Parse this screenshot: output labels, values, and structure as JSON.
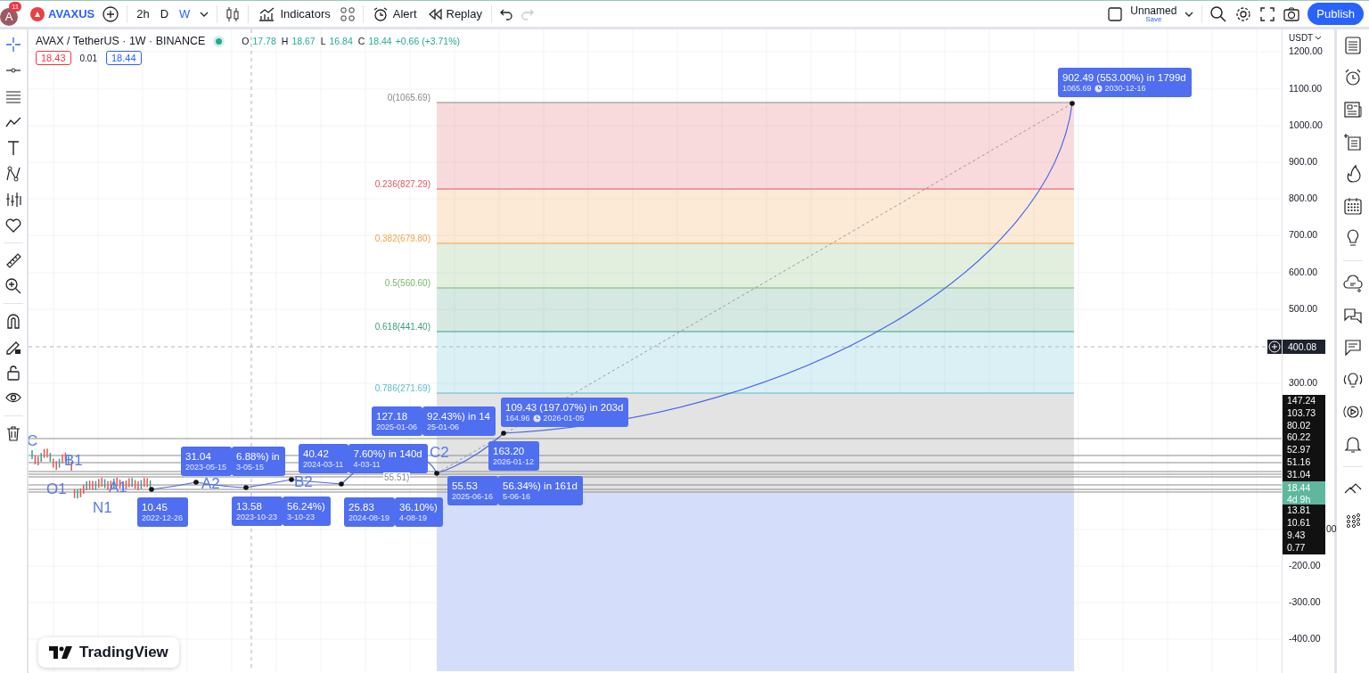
{
  "top_bar": {
    "avatar": "A",
    "notifications": "11",
    "symbol": "AVAXUS",
    "timeframes": [
      {
        "label": "2h",
        "selected": false
      },
      {
        "label": "D",
        "selected": false
      },
      {
        "label": "W",
        "selected": true
      }
    ],
    "tools": [
      {
        "kind": "indicators",
        "label": "Indicators"
      },
      {
        "kind": "alert",
        "label": "Alert"
      },
      {
        "kind": "replay",
        "label": "Replay"
      }
    ],
    "redo_disabled": true,
    "layout_name": "Unnamed",
    "save_label": "Save",
    "publish_label": "Publish"
  },
  "legend": {
    "title": "AVAX / TetherUS · 1W · BINANCE",
    "ohlc": [
      {
        "key": "O",
        "value": "17.78"
      },
      {
        "key": "H",
        "value": "18.67"
      },
      {
        "key": "L",
        "value": "16.84"
      },
      {
        "key": "C",
        "value": "18.44"
      }
    ],
    "change": "+0.66 (+3.71%)",
    "sell": "18.43",
    "spread": "0.01",
    "buy": "18.44"
  },
  "fib_levels": [
    {
      "label": "0(1065.69)",
      "color": "#8a8a8a"
    },
    {
      "label": "0.236(827.29)",
      "color": "#e0575f"
    },
    {
      "label": "0.382(679.80)",
      "color": "#f3a14b"
    },
    {
      "label": "0.5(560.60)",
      "color": "#7cb66e"
    },
    {
      "label": "0.618(441.40)",
      "color": "#3f9c7b"
    },
    {
      "label": "0.786(271.69)",
      "color": "#5bbcd0"
    }
  ],
  "fib_extra_label": "55.51)",
  "wave_labels": [
    "C",
    "B1",
    "O1",
    "A1",
    "N1",
    "A2",
    "B2",
    "C2"
  ],
  "annotations": [
    {
      "line1": "902.49 (553.00%) in 1799d",
      "line2": "1065.69",
      "line2b": "2030-12-16"
    },
    {
      "line1": "109.43 (197.07%) in 203d",
      "line2": "164.96",
      "line2b": "2026-01-05"
    },
    {
      "line1": "127.18",
      "line2": "2025-01-06"
    },
    {
      "line1": "92.43%) in 14",
      "line2": "25-01-06"
    },
    {
      "line1": "31.04",
      "line2": "2023-05-15"
    },
    {
      "line1": "6.88%) in",
      "line2": "3-05-15"
    },
    {
      "line1": "40.42",
      "line2": "2024-03-11"
    },
    {
      "line1": "7.60%) in 140d",
      "line2": "4-03-11"
    },
    {
      "line1": "163.20",
      "line2": "2026-01-12"
    },
    {
      "line1": "10.45",
      "line2": "2022-12-26"
    },
    {
      "line1": "13.58",
      "line2": "2023-10-23"
    },
    {
      "line1": "56.24%)",
      "line2": "3-10-23"
    },
    {
      "line1": "25.83",
      "line2": "2024-08-19"
    },
    {
      "line1": "36.10%)",
      "line2": "4-08-19"
    },
    {
      "line1": "55.53",
      "line2": "2025-06-16"
    },
    {
      "line1": "56.34%) in 161d",
      "line2": "5-06-16"
    }
  ],
  "price_axis": {
    "currency": "USDT",
    "ticks": [
      "1200.00",
      "1100.00",
      "1000.00",
      "900.00",
      "800.00",
      "700.00",
      "600.00",
      "500.00",
      "300.00",
      "00",
      "-200.00",
      "-300.00",
      "-400.00"
    ],
    "crosshair_price": "400.08",
    "tags": [
      {
        "value": "147.24"
      },
      {
        "value": "103.73"
      },
      {
        "value": "80.02"
      },
      {
        "value": "60.22"
      },
      {
        "value": "52.97"
      },
      {
        "value": "51.16"
      },
      {
        "value": "31.04"
      },
      {
        "value": "18.44",
        "sub": "4d 9h",
        "color": "#5fb89d"
      },
      {
        "value": "13.81"
      },
      {
        "value": "10.61"
      },
      {
        "value": "9.43"
      },
      {
        "value": "0.77"
      }
    ]
  },
  "logo": "TradingView"
}
